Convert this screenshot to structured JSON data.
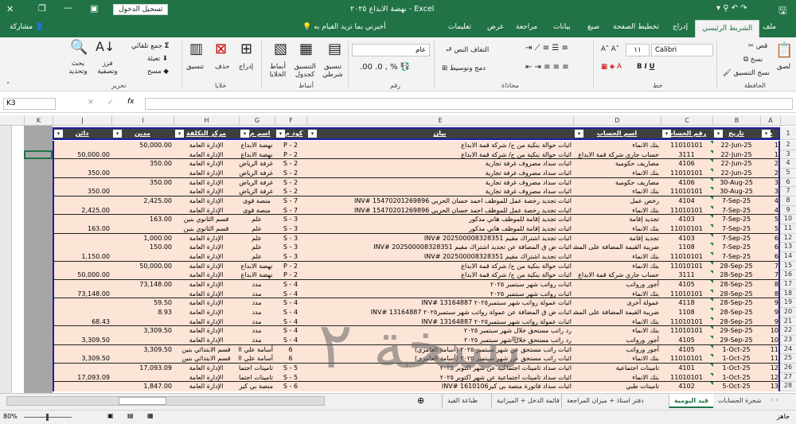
{
  "title": {
    "text": "نهضة الابداع ٢٠٢٥ - Excel",
    "signin": "تسجيل الدخول"
  },
  "tabs": [
    "ملف",
    "الشريط الرئيسي",
    "إدراج",
    "تخطيط الصفحة",
    "صيغ",
    "بيانات",
    "مراجعة",
    "عرض",
    "تعليمات"
  ],
  "tell_me": "أخبرني بما تريد القيام به",
  "share": "مشاركة",
  "ribbon": {
    "clipboard": {
      "paste": "لصق",
      "cut": "قص",
      "copy": "نسخ",
      "format_painter": "نسخ التنسيق",
      "label": "الحافظة"
    },
    "font": {
      "name": "Calibri",
      "size": "١١",
      "label": "خط"
    },
    "alignment": {
      "wrap": "التفاف النص",
      "merge": "دمج وتوسيط",
      "label": "محاذاة"
    },
    "number": {
      "format": "عام",
      "label": "رقم"
    },
    "styles": {
      "conditional": "تنسيق شرطي",
      "table": "التنسيق كجدول",
      "cell_styles": "أنماط الخلايا",
      "label": "أنماط"
    },
    "cells": {
      "insert": "إدراج",
      "delete": "حذف",
      "format": "تنسيق",
      "label": "خلايا"
    },
    "editing": {
      "autosum": "جمع تلقائي",
      "fill": "تعبئة",
      "clear": "مسح",
      "sort": "فرز وتصفية",
      "find": "بحث وتحديد",
      "label": "تحرير"
    }
  },
  "formula_bar": {
    "name_box": "K3",
    "fx": "fx",
    "value": ""
  },
  "columns": [
    "K",
    "J",
    "I",
    "H",
    "G",
    "F",
    "E",
    "D",
    "C",
    "B",
    "A"
  ],
  "headers": {
    "J": "دائن",
    "I": "مدين",
    "H": "مركز التكلفة",
    "G": "اسم م/ع",
    "F": "كود م/ع",
    "E": "بيان",
    "D": "اسم الحساب",
    "C": "رقم الحساب",
    "B": "تاريخ",
    "A": "م"
  },
  "rows": [
    {
      "n": 2,
      "A": "1",
      "B": "22-Jun-25",
      "C": "11010101",
      "D": "بنك الانماء",
      "E": "اثبات حوالة بنكية من ح/ شركة قمة الابداع",
      "F": "P - 2",
      "G": "نهضة الابداع",
      "H": "الإدارة العامة",
      "I": "50,000.00",
      "J": ""
    },
    {
      "n": 3,
      "A": "1",
      "B": "22-Jun-25",
      "C": "3111",
      "D": "حساب جاري شركة قمة الابداع",
      "E": "اثبات حوالة بنكية من ح/ شركة قمة الابداع",
      "F": "P - 2",
      "G": "نهضة الابداع",
      "H": "الإدارة العامة",
      "I": "",
      "J": "50,000.00",
      "end": true
    },
    {
      "n": 4,
      "A": "2",
      "B": "22-Jun-25",
      "C": "4106",
      "D": "مصاريف حكومية",
      "E": "اثبات سداد مصروف غرفة تجارية",
      "F": "S - 2",
      "G": "غرفة الرياض",
      "H": "الإدارة العامة",
      "I": "350.00",
      "J": ""
    },
    {
      "n": 5,
      "A": "2",
      "B": "22-Jun-25",
      "C": "11010101",
      "D": "بنك الانماء",
      "E": "اثبات سداد مصروف غرفة تجارية",
      "F": "S - 2",
      "G": "غرفة الرياض",
      "H": "الإدارة العامة",
      "I": "",
      "J": "350.00",
      "end": true
    },
    {
      "n": 6,
      "A": "3",
      "B": "30-Aug-25",
      "C": "4106",
      "D": "مصاريف حكومية",
      "E": "اثبات سداد مصروف غرفة تجارية",
      "F": "S - 2",
      "G": "غرفة الرياض",
      "H": "الإدارة العامة",
      "I": "350.00",
      "J": ""
    },
    {
      "n": 7,
      "A": "3",
      "B": "30-Aug-25",
      "C": "11010101",
      "D": "بنك الانماء",
      "E": "اثبات سداد مصروف غرفة تجارية",
      "F": "S - 2",
      "G": "غرفة الرياض",
      "H": "الإدارة العامة",
      "I": "",
      "J": "350.00",
      "end": true
    },
    {
      "n": 8,
      "A": "4",
      "B": "7-Sep-25",
      "C": "4104",
      "D": "رخص عمل",
      "E": "اثبات تجديد رخصة عمل للموظف احمد حسان الحربي 15470201269896 #INV",
      "F": "S - 7",
      "G": "منصة قوى",
      "H": "الإدارة العامة",
      "I": "2,425.00",
      "J": ""
    },
    {
      "n": 9,
      "A": "4",
      "B": "7-Sep-25",
      "C": "11010101",
      "D": "بنك الانماء",
      "E": "اثبات تجديد رخصة عمل للموظف احمد حسان الحربي 15470201269896 #INV",
      "F": "S - 7",
      "G": "منصة قوى",
      "H": "الإدارة العامة",
      "I": "",
      "J": "2,425.00",
      "end": true
    },
    {
      "n": 10,
      "A": "5",
      "B": "7-Sep-25",
      "C": "4103",
      "D": "تجديد إقامة",
      "E": "اثبات تجديد إقامة للموظف هاني مدكور",
      "F": "S - 3",
      "G": "علم",
      "H": "قسم الثانوي بنين",
      "I": "163.00",
      "J": ""
    },
    {
      "n": 11,
      "A": "5",
      "B": "7-Sep-25",
      "C": "11010101",
      "D": "بنك الانماء",
      "E": "اثبات تجديد إقامة للموظف هاني مدكور",
      "F": "S - 3",
      "G": "علم",
      "H": "قسم الثانوي بنين",
      "I": "",
      "J": "163.00",
      "end": true
    },
    {
      "n": 12,
      "A": "6",
      "B": "7-Sep-25",
      "C": "4103",
      "D": "تجديد إقامة",
      "E": "اثبات تجديد اشتراك مقيم 202500008328351 #INV",
      "F": "S - 3",
      "G": "علم",
      "H": "الإدارة العامة",
      "I": "1,000.00",
      "J": ""
    },
    {
      "n": 13,
      "A": "6",
      "B": "7-Sep-25",
      "C": "1108",
      "D": "ضريبة القيمة المضافة على المشتريات",
      "E": "اثبات ض ق المضافة عن تجديد اشتراك مقيم 202500008328351 #INV",
      "F": "S - 3",
      "G": "علم",
      "H": "الإدارة العامة",
      "I": "150.00",
      "J": ""
    },
    {
      "n": 14,
      "A": "6",
      "B": "7-Sep-25",
      "C": "11010101",
      "D": "بنك الانماء",
      "E": "اثبات تجديد اشتراك مقيم 202500008328351 #INV",
      "F": "S - 3",
      "G": "علم",
      "H": "الإدارة العامة",
      "I": "",
      "J": "1,150.00",
      "end": true
    },
    {
      "n": 15,
      "A": "7",
      "B": "28-Sep-25",
      "C": "11010101",
      "D": "بنك الانماء",
      "E": "اثبات حوالة بنكية من ح/ شركة قمة الابداع",
      "F": "P - 2",
      "G": "نهضة الابداع",
      "H": "الإدارة العامة",
      "I": "50,000.00",
      "J": ""
    },
    {
      "n": 16,
      "A": "7",
      "B": "28-Sep-25",
      "C": "3111",
      "D": "حساب جاري شركة قمة الابداع",
      "E": "اثبات حوالة بنكية من ح/ شركة قمة الابداع",
      "F": "P - 2",
      "G": "نهضة الابداع",
      "H": "الإدارة العامة",
      "I": "",
      "J": "50,000.00",
      "end": true
    },
    {
      "n": 17,
      "A": "8",
      "B": "28-Sep-25",
      "C": "4105",
      "D": "أجور ورواتب",
      "E": "اثبات رواتب شهر سبتمبر ٢٠٢٥",
      "F": "S - 4",
      "G": "مدد",
      "H": "الإدارة العامة",
      "I": "73,148.00",
      "J": ""
    },
    {
      "n": 18,
      "A": "8",
      "B": "28-Sep-25",
      "C": "11010101",
      "D": "بنك الانماء",
      "E": "اثبات رواتب شهر سبتمبر ٢٠٢٥",
      "F": "S - 4",
      "G": "مدد",
      "H": "الإدارة العامة",
      "I": "",
      "J": "73,148.00",
      "end": true
    },
    {
      "n": 19,
      "A": "9",
      "B": "28-Sep-25",
      "C": "4118",
      "D": "عمولة أخرى",
      "E": "اثبات عمولة رواتب شهر سبتمبر٢٠٢٥ 13164887 #INV",
      "F": "S - 4",
      "G": "مدد",
      "H": "الإدارة العامة",
      "I": "59.50",
      "J": ""
    },
    {
      "n": 20,
      "A": "9",
      "B": "28-Sep-25",
      "C": "1108",
      "D": "ضريبة القيمة المضافة على المشتريات",
      "E": "اثبات ض ق المضافة عن عمولة رواتب شهر سبتمبر٢٠٢٥ 13164887 #INV",
      "F": "S - 4",
      "G": "مدد",
      "H": "الإدارة العامة",
      "I": "8.93",
      "J": ""
    },
    {
      "n": 21,
      "A": "9",
      "B": "28-Sep-25",
      "C": "11010101",
      "D": "بنك الانماء",
      "E": "اثبات عمولة رواتب شهر سبتمبر٢٠٢٥ 13164887 #INV",
      "F": "S - 4",
      "G": "مدد",
      "H": "الإدارة العامة",
      "I": "",
      "J": "68.43",
      "end": true
    },
    {
      "n": 22,
      "A": "10",
      "B": "29-Sep-25",
      "C": "11010101",
      "D": "بنك الانماء",
      "E": "رد راتب مستحق خلال شهر سبتمبر ٢٠٢٥",
      "F": "S - 4",
      "G": "مدد",
      "H": "الإدارة العامة",
      "I": "3,309.50",
      "J": ""
    },
    {
      "n": 23,
      "A": "10",
      "B": "29-Sep-25",
      "C": "4105",
      "D": "أجور ورواتب",
      "E": "رد راتب مستحق خلال شهر سبتمبر ٢٠٢٥",
      "F": "S - 4",
      "G": "مدد",
      "H": "الإدارة العامة",
      "I": "",
      "J": "3,309.50",
      "end": true
    },
    {
      "n": 24,
      "A": "11",
      "B": "1-Oct-25",
      "C": "4105",
      "D": "أجور ورواتب",
      "E": "اثبات راتب مستحق عن شهر سبتمبر ٢٠٢٥ (أسامة العامري)",
      "F": "6",
      "G": "أسامة علي العمري",
      "H": "قسم الابتدائي بنين",
      "I": "3,309.50",
      "J": ""
    },
    {
      "n": 25,
      "A": "11",
      "B": "1-Oct-25",
      "C": "11010101",
      "D": "بنك الانماء",
      "E": "اثبات راتب مستحق عن شهر سبتمبر ٢٠٢٥ (أسامة العامري)",
      "F": "6",
      "G": "أسامة علي العمري",
      "H": "قسم الابتدائي بنين",
      "I": "",
      "J": "3,309.50",
      "end": true
    },
    {
      "n": 26,
      "A": "12",
      "B": "1-Oct-25",
      "C": "4101",
      "D": "تامينات اجتماعية",
      "E": "اثبات سداد تامينات اجتماعية عن شهر اكتوبر ٢٠٢٥",
      "F": "S - 5",
      "G": "تامينات اجتماعية",
      "H": "الإدارة العامة",
      "I": "17,093.09",
      "J": ""
    },
    {
      "n": 27,
      "A": "12",
      "B": "1-Oct-25",
      "C": "11010101",
      "D": "بنك الانماء",
      "E": "اثبات سداد تامينات اجتماعية عن شهر اكتوبر ٢٠٢٥",
      "F": "S - 5",
      "G": "تامينات اجتماعية",
      "H": "الإدارة العامة",
      "I": "",
      "J": "17,093.09",
      "end": true
    },
    {
      "n": 28,
      "A": "13",
      "B": "5-Oct-25",
      "C": "4102",
      "D": "تامينات طبي",
      "E": "اثبات سداد فاتورة منصة بي كير1610106 #INV",
      "F": "S - 6",
      "G": "منصة بي كير",
      "H": "الإدارة العامة",
      "I": "1,847.00",
      "J": ""
    }
  ],
  "watermark": "نسخة ٢",
  "sheet_tabs": [
    "شجرة الحسابات",
    "قيد اليومية",
    "دفتر استاذ + ميزان المراجعة",
    "قائمة الدخل + الميزانية",
    "طباعة القيد"
  ],
  "active_sheet": 1,
  "status": {
    "ready": "جاهز",
    "zoom": "80%"
  },
  "colors": {
    "excel_green": "#217346",
    "row_fill": "#fce4d6",
    "header_fill": "#3f3f3f",
    "table_border": "#1f1fa8"
  }
}
